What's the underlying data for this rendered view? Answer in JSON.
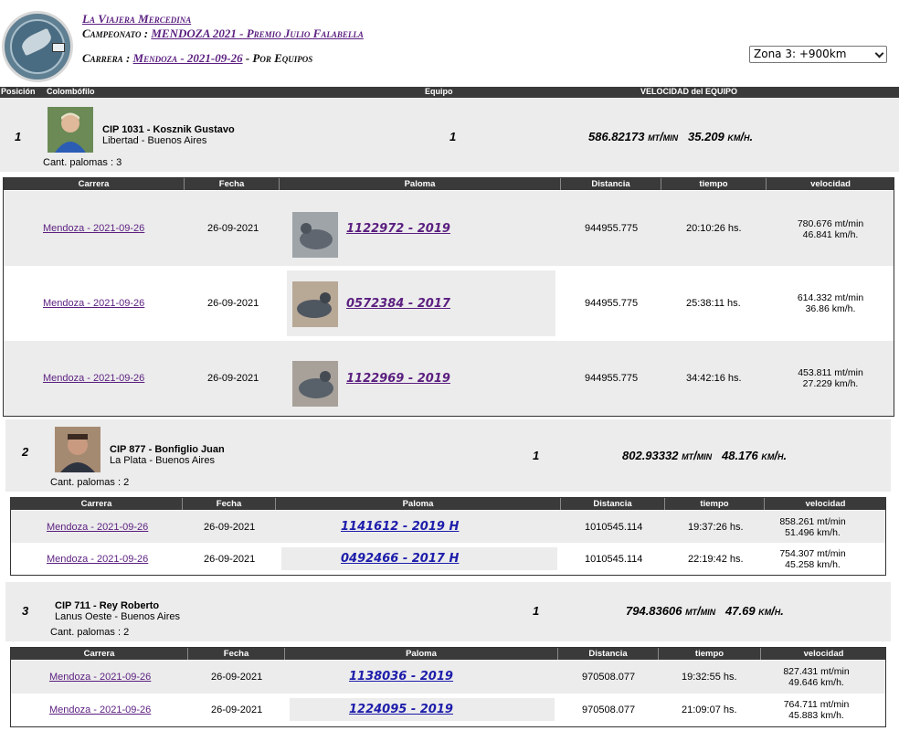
{
  "header": {
    "club": "La Viajera Mercedina",
    "campeonato_label": "Campeonato :",
    "campeonato_value": "MENDOZA 2021 - Premio Julio Falabella",
    "carrera_label": "Carrera :",
    "carrera_value": "Mendoza - 2021-09-26",
    "carrera_suffix": " - Por Equipos",
    "zona_selected": "Zona 3: +900km"
  },
  "columns": {
    "posicion": "Posición",
    "colombofilo": "Colombófilo",
    "equipo": "Equipo",
    "velocidad": "VELOCIDAD del EQUIPO"
  },
  "sub_columns": {
    "carrera": "Carrera",
    "fecha": "Fecha",
    "paloma": "Paloma",
    "distancia": "Distancia",
    "tiempo": "tiempo",
    "velocidad": "velocidad"
  },
  "teams": [
    {
      "pos": "1",
      "name": "CIP 1031 - Kosznik Gustavo",
      "loc": "Libertad - Buenos Aires",
      "cant": "Cant. palomas : 3",
      "equipo": "1",
      "vel_mt": "586.82173 mt/min",
      "vel_km": "35.209 km/h.",
      "rows": [
        {
          "carrera": "Mendoza - 2021-09-26",
          "fecha": "26-09-2021",
          "paloma": "1122972 - 2019",
          "dist": "944955.775",
          "tiempo": "20:10:26 hs.",
          "v1": "780.676 mt/min",
          "v2": "46.841 km/h."
        },
        {
          "carrera": "Mendoza - 2021-09-26",
          "fecha": "26-09-2021",
          "paloma": "0572384 - 2017",
          "dist": "944955.775",
          "tiempo": "25:38:11 hs.",
          "v1": "614.332 mt/min",
          "v2": "36.86 km/h."
        },
        {
          "carrera": "Mendoza - 2021-09-26",
          "fecha": "26-09-2021",
          "paloma": "1122969 - 2019",
          "dist": "944955.775",
          "tiempo": "34:42:16 hs.",
          "v1": "453.811 mt/min",
          "v2": "27.229 km/h."
        }
      ]
    },
    {
      "pos": "2",
      "name": "CIP 877 - Bonfiglio Juan",
      "loc": "La Plata - Buenos Aires",
      "cant": "Cant. palomas : 2",
      "equipo": "1",
      "vel_mt": "802.93332 mt/min",
      "vel_km": "48.176 km/h.",
      "rows": [
        {
          "carrera": "Mendoza - 2021-09-26",
          "fecha": "26-09-2021",
          "paloma": "1141612 - 2019 H",
          "dist": "1010545.114",
          "tiempo": "19:37:26 hs.",
          "v1": "858.261 mt/min",
          "v2": "51.496 km/h."
        },
        {
          "carrera": "Mendoza - 2021-09-26",
          "fecha": "26-09-2021",
          "paloma": "0492466 - 2017 H",
          "dist": "1010545.114",
          "tiempo": "22:19:42 hs.",
          "v1": "754.307 mt/min",
          "v2": "45.258 km/h."
        }
      ]
    },
    {
      "pos": "3",
      "name": "CIP 711 - Rey Roberto",
      "loc": "Lanus Oeste - Buenos Aires",
      "cant": "Cant. palomas : 2",
      "equipo": "1",
      "vel_mt": "794.83606 mt/min",
      "vel_km": "47.69 km/h.",
      "rows": [
        {
          "carrera": "Mendoza - 2021-09-26",
          "fecha": "26-09-2021",
          "paloma": "1138036 - 2019",
          "dist": "970508.077",
          "tiempo": "19:32:55 hs.",
          "v1": "827.431 mt/min",
          "v2": "49.646 km/h."
        },
        {
          "carrera": "Mendoza - 2021-09-26",
          "fecha": "26-09-2021",
          "paloma": "1224095 - 2019",
          "dist": "970508.077",
          "tiempo": "21:09:07 hs.",
          "v1": "764.711 mt/min",
          "v2": "45.883 km/h."
        }
      ]
    }
  ]
}
